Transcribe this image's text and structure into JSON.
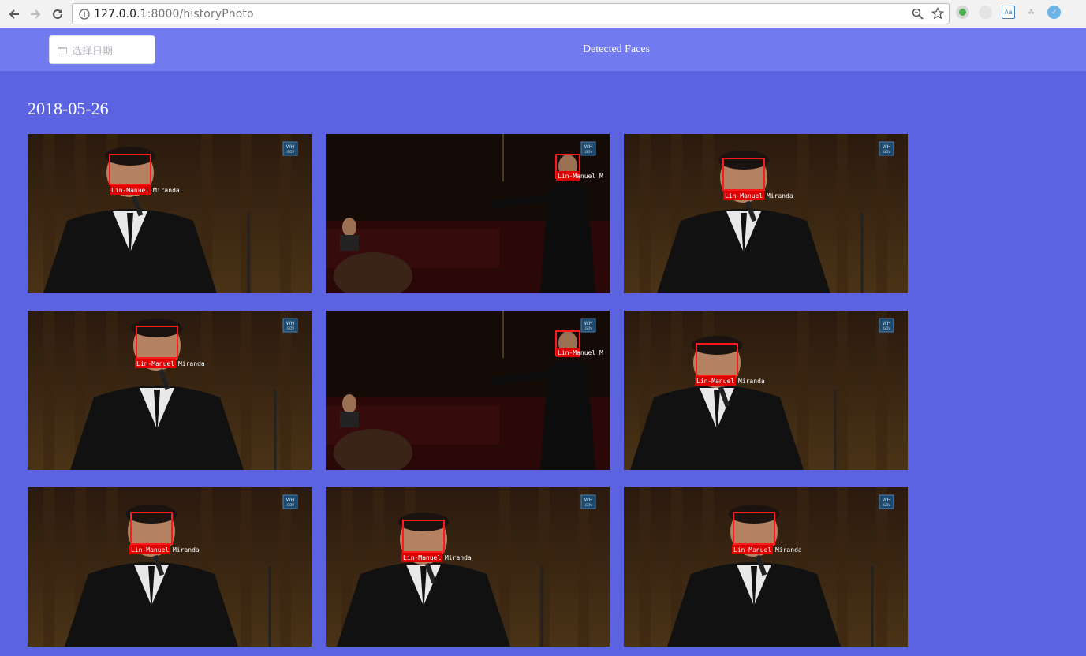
{
  "browser": {
    "url_host": "127.0.0.1",
    "url_path": ":8000/historyPhoto"
  },
  "header": {
    "date_placeholder": "选择日期",
    "title": "Detected Faces"
  },
  "gallery": {
    "date": "2018-05-26",
    "photos": [
      {
        "label": "Lin-Manuel Miranda",
        "watermark": "WH .GOV"
      },
      {
        "label": "Lin-Manuel M",
        "watermark": "WH .GOV"
      },
      {
        "label": "Lin-Manuel Miranda",
        "watermark": "WH .GOV"
      },
      {
        "label": "Lin-Manuel Miranda",
        "watermark": "WH .GOV"
      },
      {
        "label": "Lin-Manuel M",
        "watermark": "WH .GOV"
      },
      {
        "label": "Lin-Manuel Miranda",
        "watermark": "WH .GOV"
      },
      {
        "label": "Lin-Manuel Miranda",
        "watermark": "WH .GOV"
      },
      {
        "label": "Lin-Manuel Miranda",
        "watermark": "WH .GOV"
      },
      {
        "label": "Lin-Manuel Miranda",
        "watermark": "WH .GOV"
      }
    ]
  },
  "colors": {
    "page_bg": "#5b63e0",
    "header_bg": "#727af0",
    "face_box": "#ff0000"
  }
}
